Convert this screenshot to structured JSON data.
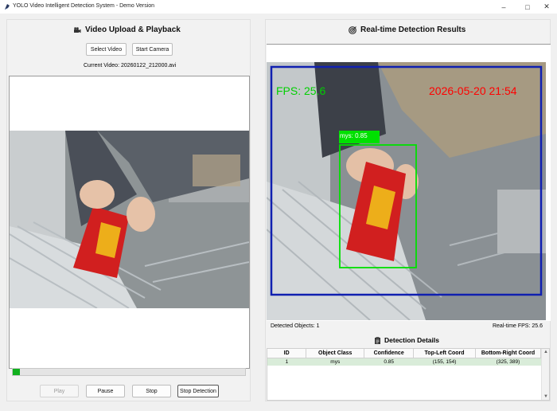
{
  "window": {
    "title": "YOLO Video Intelligent Detection System - Demo Version"
  },
  "left_panel": {
    "title": "Video Upload & Playback",
    "title_icon": "movie-camera-icon",
    "select_video_label": "Select Video",
    "start_camera_label": "Start Camera",
    "current_video_prefix": "Current Video: ",
    "current_video_name": "20260122_212000.avi",
    "progress": 0.03,
    "controls": {
      "play_label": "Play",
      "pause_label": "Pause",
      "stop_label": "Stop",
      "stop_detection_label": "Stop Detection"
    }
  },
  "right_panel": {
    "title": "Real-time Detection Results",
    "title_icon": "target-icon",
    "overlay": {
      "fps_text": "FPS: 25.6",
      "timestamp_text": "2026-05-20 21:54",
      "box_label": "mys: 0.85"
    },
    "detected_objects_text": "Detected Objects: 1",
    "realtime_fps_text": "Real-time FPS: 25.6",
    "details_title": "Detection Details",
    "details_icon": "clipboard-icon",
    "table": {
      "columns": [
        "ID",
        "Object Class",
        "Confidence",
        "Top-Left Coord",
        "Bottom-Right Coord"
      ],
      "rows": [
        {
          "id": "1",
          "object_class": "mys",
          "confidence": "0.85",
          "top_left": "(155, 154)",
          "bottom_right": "(325, 389)"
        }
      ]
    }
  },
  "colors": {
    "progress_fill": "#11b01e",
    "overlay_fps": "#00d000",
    "overlay_timestamp": "#ff0000",
    "frame_box": "#1020b0",
    "detection_box": "#00e000",
    "row_highlight": "#d9ecd9"
  }
}
